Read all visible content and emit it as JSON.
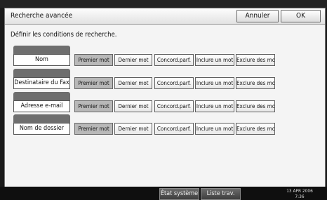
{
  "header": {
    "title": "Recherche avancée",
    "cancel_label": "Annuler",
    "ok_label": "OK"
  },
  "instruction": "Définir les conditions de recherche.",
  "rows": [
    {
      "field": "Nom"
    },
    {
      "field": "Destinataire du Fax"
    },
    {
      "field": "Adresse e-mail"
    },
    {
      "field": "Nom de dossier"
    }
  ],
  "options": [
    "Premier mot",
    "Dernier mot",
    "Concord.parf.",
    "Inclure un mot",
    "Exclure des mots"
  ],
  "selected_option": "Premier mot",
  "statusbar": {
    "system_status_label": "État système",
    "job_list_label": "Liste trav.",
    "date": "13 APR 2006",
    "time": "7:36"
  }
}
